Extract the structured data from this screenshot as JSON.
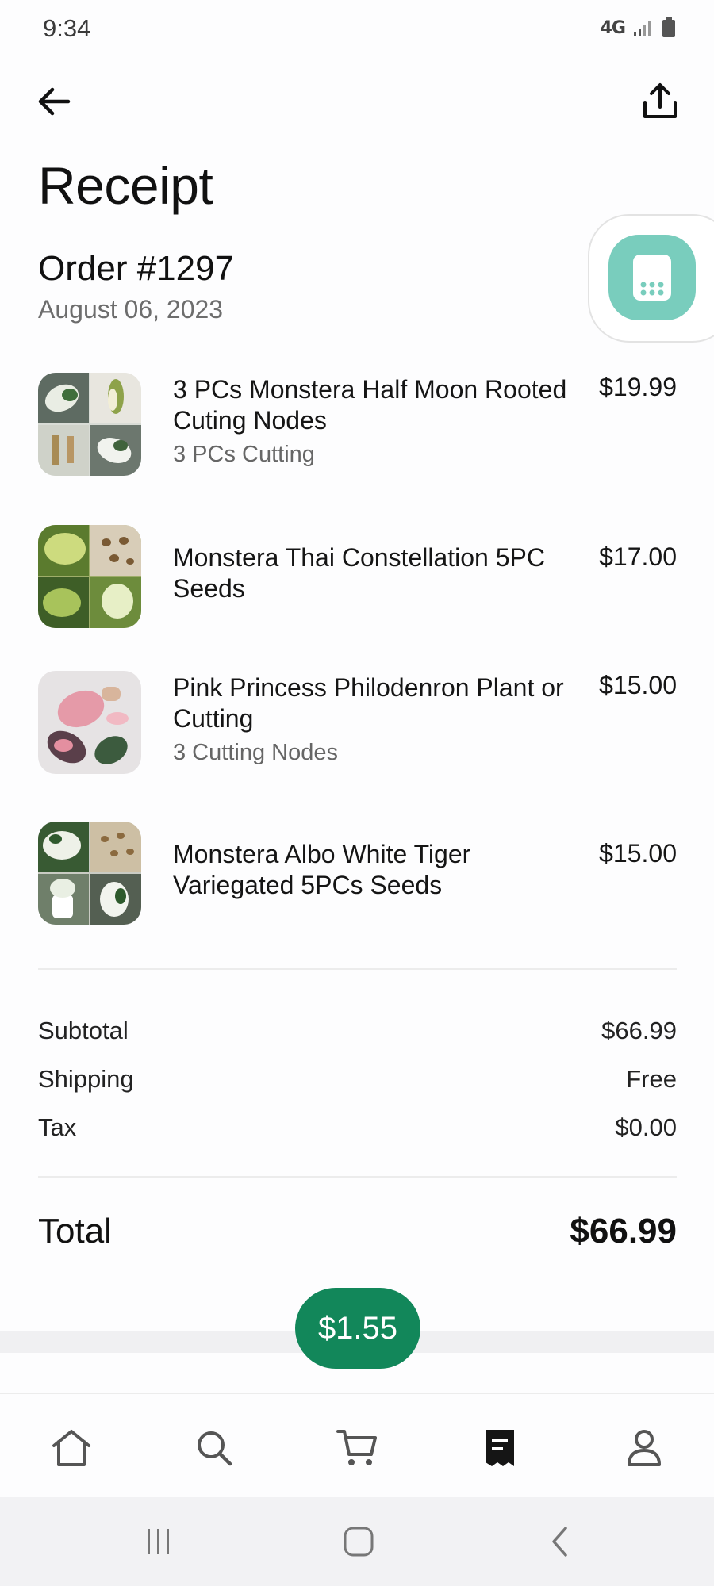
{
  "status_bar": {
    "time": "9:34",
    "network": "4G",
    "icons": [
      "network-4g-icon",
      "signal-icon",
      "battery-icon"
    ]
  },
  "header": {
    "back_icon": "arrow-left-icon",
    "share_icon": "share-upload-icon"
  },
  "page": {
    "title": "Receipt",
    "order_number": "Order #1297",
    "order_date": "August 06, 2023"
  },
  "floating_widget": {
    "icon": "calculator-icon",
    "color": "#79cdbd"
  },
  "items": [
    {
      "title": "3 PCs Monstera Half Moon Rooted Cuting Nodes",
      "variant": "3 PCs Cutting",
      "price": "$19.99"
    },
    {
      "title": "Monstera Thai Constellation 5PC Seeds",
      "variant": "",
      "price": "$17.00"
    },
    {
      "title": "Pink Princess Philodenron Plant or Cutting",
      "variant": "3 Cutting Nodes",
      "price": "$15.00"
    },
    {
      "title": "Monstera Albo White Tiger Variegated 5PCs Seeds",
      "variant": "",
      "price": "$15.00"
    }
  ],
  "summary": {
    "subtotal_label": "Subtotal",
    "subtotal_value": "$66.99",
    "shipping_label": "Shipping",
    "shipping_value": "Free",
    "tax_label": "Tax",
    "tax_value": "$0.00",
    "total_label": "Total",
    "total_value": "$66.99"
  },
  "tip_pill": {
    "label": "$1.55",
    "color": "#12875a"
  },
  "bottom_nav": [
    {
      "icon": "home-icon",
      "active": false
    },
    {
      "icon": "search-icon",
      "active": false
    },
    {
      "icon": "cart-icon",
      "active": false
    },
    {
      "icon": "receipt-icon",
      "active": true
    },
    {
      "icon": "profile-icon",
      "active": false
    }
  ],
  "system_nav": [
    "recent-apps-icon",
    "home-circle-icon",
    "system-back-icon"
  ]
}
